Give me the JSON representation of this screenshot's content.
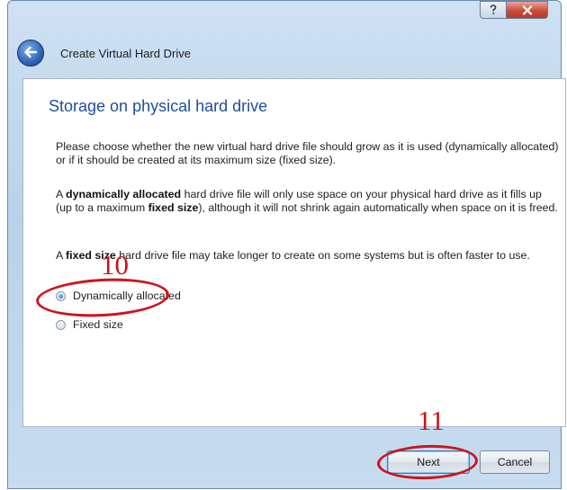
{
  "window": {
    "title": "Create Virtual Hard Drive",
    "controls": {
      "help_icon": "question-icon",
      "close_icon": "close-icon"
    }
  },
  "page": {
    "heading": "Storage on physical hard drive",
    "paragraph1": "Please choose whether the new virtual hard drive file should grow as it is used (dynamically allocated) or if it should be created at its maximum size (fixed size).",
    "paragraph2": {
      "prefix": "A ",
      "bold1": "dynamically allocated",
      "mid": " hard drive file will only use space on your physical hard drive as it fills up (up to a maximum ",
      "bold2": "fixed size",
      "suffix": "), although it will not shrink again automatically when space on it is freed."
    },
    "paragraph3": {
      "prefix": "A ",
      "bold": "fixed size",
      "suffix": " hard drive file may take longer to create on some systems but is often faster to use."
    },
    "options": [
      {
        "label": "Dynamically allocated",
        "checked": true
      },
      {
        "label": "Fixed size",
        "checked": false
      }
    ]
  },
  "footer": {
    "next_label": "Next",
    "cancel_label": "Cancel"
  },
  "annotations": {
    "step_10": "10",
    "step_11": "11",
    "color": "#d0131c"
  },
  "colors": {
    "heading": "#1f4f9b",
    "window_frame": "#b9d1ea",
    "close_button": "#c94e3a"
  }
}
